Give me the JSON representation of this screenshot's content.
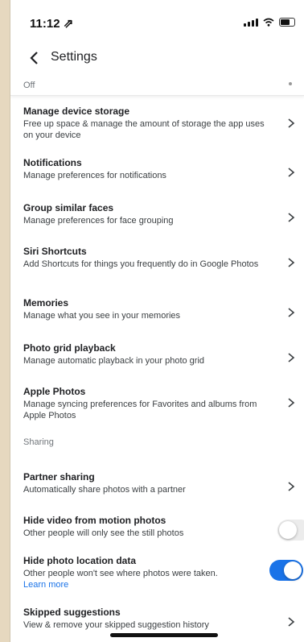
{
  "status_bar": {
    "time": "11:12 ⇗"
  },
  "nav": {
    "title": "Settings"
  },
  "partial_row": {
    "label": "Off"
  },
  "items": [
    {
      "title": "Manage device storage",
      "subtitle": "Free up space & manage the amount of storage the app uses on your device"
    },
    {
      "title": "Notifications",
      "subtitle": "Manage preferences for notifications"
    },
    {
      "title": "Group similar faces",
      "subtitle": "Manage preferences for face grouping"
    },
    {
      "title": "Siri Shortcuts",
      "subtitle": "Add Shortcuts for things you frequently do in Google Photos"
    },
    {
      "title": "Memories",
      "subtitle": "Manage what you see in your memories"
    },
    {
      "title": "Photo grid playback",
      "subtitle": "Manage automatic playback in your photo grid"
    },
    {
      "title": "Apple Photos",
      "subtitle": "Manage syncing preferences for Favorites and albums from Apple Photos"
    }
  ],
  "sharing": {
    "header": "Sharing",
    "partner": {
      "title": "Partner sharing",
      "subtitle": "Automatically share photos with a partner"
    },
    "hide_video": {
      "title": "Hide video from motion photos",
      "subtitle": "Other people will only see the still photos",
      "enabled": false
    },
    "hide_location": {
      "title": "Hide photo location data",
      "subtitle": "Other people won't see where photos were taken.",
      "learn_more": "Learn more",
      "enabled": true
    },
    "skipped": {
      "title": "Skipped suggestions",
      "subtitle": "View & remove your skipped suggestion history"
    }
  },
  "colors": {
    "accent": "#1a73e8",
    "text": "#202124",
    "background": "#ffffff"
  }
}
